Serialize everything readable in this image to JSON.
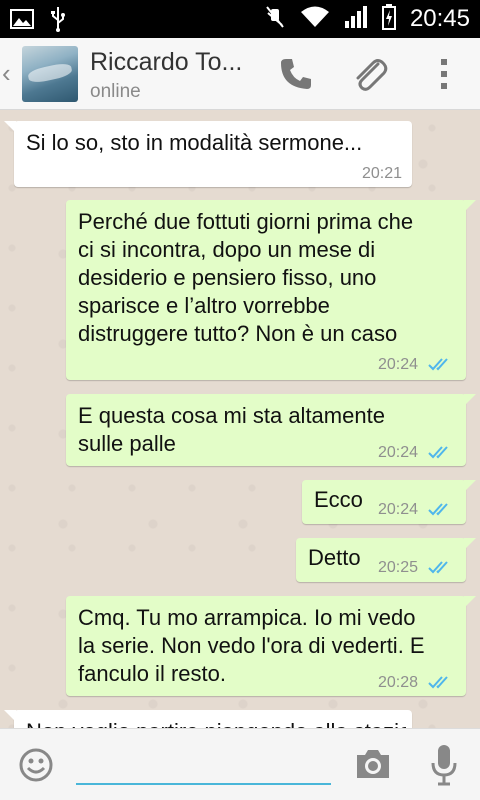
{
  "status_bar": {
    "time": "20:45",
    "icons": [
      "gallery-icon",
      "usb-icon",
      "mute-icon",
      "wifi-icon",
      "signal-icon",
      "battery-charging-icon"
    ]
  },
  "header": {
    "contact_name": "Riccardo To...",
    "status": "online",
    "icons": [
      "back-chevron-icon",
      "avatar",
      "call-icon",
      "attach-icon",
      "overflow-menu-icon"
    ]
  },
  "messages": [
    {
      "direction": "in",
      "lines": [
        "Si lo so, sto in modalità sermone..."
      ],
      "time": "20:21",
      "ticks": false
    },
    {
      "direction": "out",
      "lines": [
        "Perché due fottuti giorni prima che",
        "ci si incontra, dopo un mese di",
        "desiderio e pensiero fisso, uno",
        "sparisce e l’altro vorrebbe",
        "distruggere tutto? Non è un caso"
      ],
      "time": "20:24",
      "ticks": true
    },
    {
      "direction": "out",
      "lines": [
        "E questa cosa mi sta altamente",
        "sulle palle"
      ],
      "time": "20:24",
      "ticks": true
    },
    {
      "direction": "out",
      "lines": [
        "Ecco"
      ],
      "time": "20:24",
      "ticks": true
    },
    {
      "direction": "out",
      "lines": [
        "Detto"
      ],
      "time": "20:25",
      "ticks": true
    },
    {
      "direction": "out",
      "lines": [
        "Cmq. Tu mo arrampica. Io mi vedo",
        "la serie. Non vedo l'ora di vederti. E",
        "fanculo il resto."
      ],
      "time": "20:28",
      "ticks": true
    },
    {
      "direction": "in",
      "lines": [
        "Non voglio partire piangendo alla stazione"
      ],
      "time": "",
      "ticks": false
    }
  ],
  "input_bar": {
    "placeholder": "",
    "icons": [
      "emoji-icon",
      "camera-icon",
      "microphone-icon"
    ]
  },
  "colors": {
    "incoming_bubble": "#ffffff",
    "outgoing_bubble": "#e3fdc8",
    "read_ticks": "#4fb6ec",
    "input_underline": "#49b6d9"
  }
}
